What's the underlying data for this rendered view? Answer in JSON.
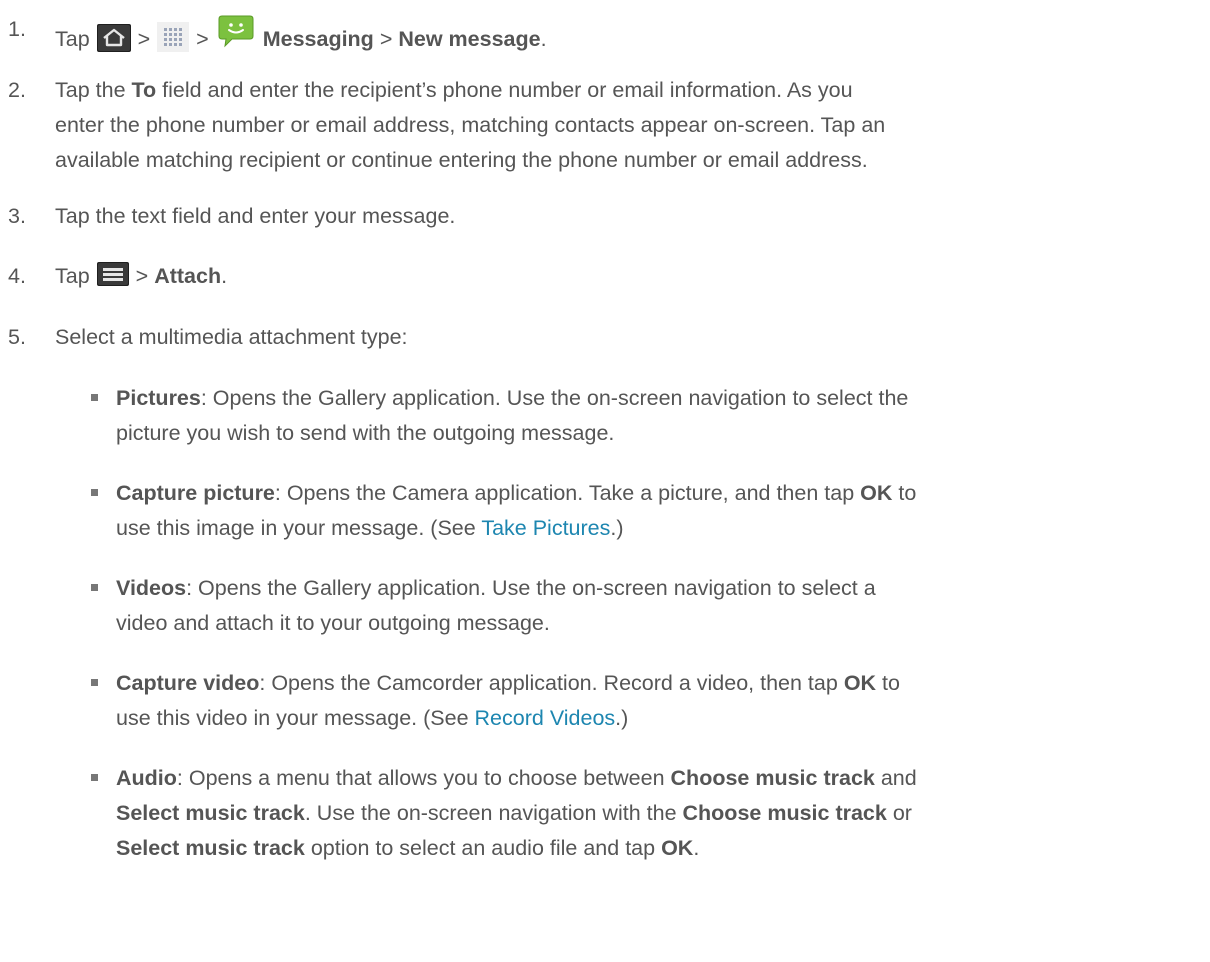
{
  "steps": [
    {
      "num": "1.",
      "tap": "Tap",
      "sep1": ">",
      "sep2": ">",
      "app": "Messaging",
      "sep3": ">",
      "target": "New message",
      "end": "."
    },
    {
      "num": "2.",
      "pre": "Tap the",
      "field": "To",
      "line1_rest": "field and enter the recipient’s phone number or email information. As you",
      "line2": "enter the phone number or email address, matching contacts appear on-screen. Tap an",
      "line3": "available matching recipient or continue entering the phone number or email address."
    },
    {
      "num": "3.",
      "text": "Tap the text field and enter your message."
    },
    {
      "num": "4.",
      "tap": "Tap",
      "sep": ">",
      "target": "Attach",
      "end": "."
    },
    {
      "num": "5.",
      "text": "Select a multimedia attachment type:"
    }
  ],
  "options": [
    {
      "name": "Pictures",
      "line1": ": Opens the Gallery application. Use the on-screen navigation to select the",
      "line2": "picture you wish to send with the outgoing message."
    },
    {
      "name": "Capture picture",
      "line1": ": Opens the Camera application. Take a picture, and then tap",
      "ok": "OK",
      "line1_end": "to",
      "line2_pre": "use this image in your message. (See",
      "link": "Take Pictures",
      "line2_end": ".)"
    },
    {
      "name": "Videos",
      "line1": ": Opens the Gallery application. Use the on-screen navigation to select a",
      "line2": "video and attach it to your outgoing message."
    },
    {
      "name": "Capture video",
      "line1": ": Opens the Camcorder application. Record a video, then tap",
      "ok": "OK",
      "line1_end": "to",
      "line2_pre": "use this video in your message. (See",
      "link": "Record Videos",
      "line2_end": ".)"
    },
    {
      "name": "Audio",
      "line1": ": Opens a menu that allows you to choose between",
      "choose": "Choose music track",
      "and": "and",
      "select": "Select music track",
      "line2_mid": ". Use the on-screen navigation with the",
      "choose2": "Choose music track",
      "or": "or",
      "select2": "Select music track",
      "line3_mid": "option to select an audio file and tap",
      "ok": "OK",
      "end": "."
    }
  ],
  "icons": {
    "home": "home-icon",
    "apps": "apps-grid-icon",
    "messaging": "messaging-app-icon",
    "menu": "menu-icon"
  },
  "colors": {
    "text": "#555555",
    "link": "#1d86b0"
  }
}
